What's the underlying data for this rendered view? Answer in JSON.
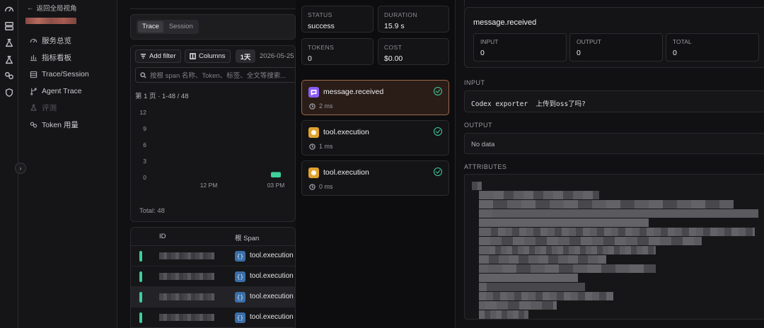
{
  "rail": {
    "icons": [
      "gauge-icon",
      "list-icon",
      "flask-icon",
      "flask-icon",
      "link-icon",
      "shield-icon"
    ]
  },
  "sidebar": {
    "back_label": "返回全局视角",
    "items": [
      {
        "label": "服务总览",
        "icon": "gauge-icon",
        "disabled": false
      },
      {
        "label": "指标看板",
        "icon": "bar-chart-icon",
        "disabled": false
      },
      {
        "label": "Trace/Session",
        "icon": "list-icon",
        "disabled": false
      },
      {
        "label": "Agent Trace",
        "icon": "branch-icon",
        "disabled": false
      },
      {
        "label": "评测",
        "icon": "flask-icon",
        "disabled": true
      },
      {
        "label": "Token 用量",
        "icon": "link-icon",
        "disabled": false
      }
    ]
  },
  "list": {
    "tabs": [
      {
        "label": "Trace",
        "active": true
      },
      {
        "label": "Session",
        "active": false
      }
    ],
    "add_filter": "Add filter",
    "columns": "Columns",
    "range": "1天",
    "date": "2026-05-25",
    "search_placeholder": "按根 span 名称、Token、标签、全文等搜索...",
    "page_info": "第 1 页 · 1-48 / 48",
    "total": "Total: 48",
    "table": {
      "col_id": "ID",
      "col_root_span": "根 Span",
      "rows": [
        {
          "span": "tool.execution",
          "highlight": false
        },
        {
          "span": "tool.execution",
          "highlight": false
        },
        {
          "span": "tool.execution",
          "highlight": true
        },
        {
          "span": "tool.execution",
          "highlight": false
        }
      ]
    }
  },
  "chart_data": {
    "type": "bar",
    "y_ticks": [
      "12",
      "9",
      "6",
      "3",
      "0"
    ],
    "x_ticks": [
      "12 PM",
      "03 PM"
    ],
    "ylim": [
      0,
      12
    ],
    "bars": [
      {
        "x": "03 PM",
        "value": 1
      }
    ],
    "color": "#3ecf9a",
    "grid": false
  },
  "summary": {
    "status_label": "STATUS",
    "status": "success",
    "duration_label": "DURATION",
    "duration": "15.9 s",
    "tokens_label": "TOKENS",
    "tokens": "0",
    "cost_label": "COST",
    "cost": "$0.00"
  },
  "spans": [
    {
      "name": "message.received",
      "duration": "2 ms",
      "icon": "message-icon",
      "icon_color": "#8b5cf6",
      "selected": true
    },
    {
      "name": "tool.execution",
      "duration": "1 ms",
      "icon": "tool-icon",
      "icon_color": "#e0a22e",
      "selected": false
    },
    {
      "name": "tool.execution",
      "duration": "0 ms",
      "icon": "tool-icon",
      "icon_color": "#e0a22e",
      "selected": false
    }
  ],
  "detail": {
    "title": "message.received",
    "input_label": "INPUT",
    "input_tokens": "0",
    "output_label": "OUTPUT",
    "output_tokens": "0",
    "total_label": "TOTAL",
    "total_tokens": "0",
    "section_input": "INPUT",
    "input_text": "Codex exporter  上传到oss了吗?",
    "section_output": "OUTPUT",
    "output_text": "No data",
    "section_attributes": "ATTRIBUTES"
  }
}
